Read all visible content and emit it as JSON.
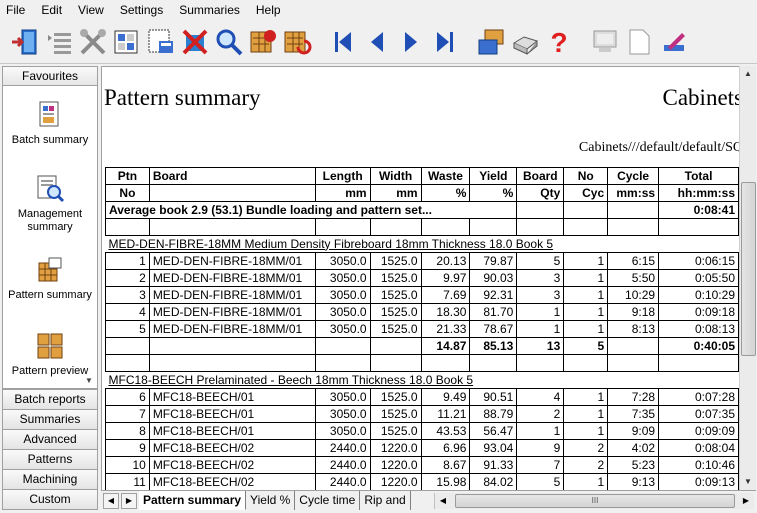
{
  "menu": [
    "File",
    "Edit",
    "View",
    "Settings",
    "Summaries",
    "Help"
  ],
  "toolbar": {
    "buttons": [
      "exit-icon",
      "list-icon",
      "tools-icon",
      "batch-icon",
      "data-icon",
      "delete-icon",
      "search-icon",
      "report-icon",
      "refresh-icon",
      "first-icon",
      "previous-icon",
      "next-icon",
      "last-icon",
      "export-icon",
      "print-icon",
      "help-icon",
      "computer-icon",
      "page-icon",
      "edit-icon"
    ]
  },
  "nav": {
    "header": "Favourites",
    "entries": [
      {
        "label": "Batch summary",
        "icon": "batch-summary-icon"
      },
      {
        "label": "Management summary",
        "icon": "management-summary-icon"
      },
      {
        "label": "Pattern summary",
        "icon": "pattern-summary-icon"
      },
      {
        "label": "Pattern preview",
        "icon": "pattern-preview-icon"
      }
    ],
    "sections": [
      "Batch reports",
      "Summaries",
      "Advanced",
      "Patterns",
      "Machining",
      "Custom"
    ]
  },
  "report": {
    "title": "Pattern summary",
    "company": "Cabinets",
    "path": "Cabinets///default/default/SQ",
    "headers1": [
      "Ptn",
      "Board",
      "Length",
      "Width",
      "Waste",
      "Yield",
      "Board",
      "No",
      "Cycle",
      "Total"
    ],
    "headers2": [
      "No",
      "",
      "mm",
      "mm",
      "%",
      "%",
      "Qty",
      "Cyc",
      "mm:ss",
      "hh:mm:ss"
    ],
    "average": {
      "label": "Average book 2.9 (53.1) Bundle loading and pattern set...",
      "total": "0:08:41"
    },
    "groups": [
      {
        "label": "MED-DEN-FIBRE-18MM Medium Density Fibreboard 18mm Thickness  18.0 Book 5",
        "rows": [
          [
            "1",
            "MED-DEN-FIBRE-18MM/01",
            "3050.0",
            "1525.0",
            "20.13",
            "79.87",
            "5",
            "1",
            "6:15",
            "0:06:15"
          ],
          [
            "2",
            "MED-DEN-FIBRE-18MM/01",
            "3050.0",
            "1525.0",
            "9.97",
            "90.03",
            "3",
            "1",
            "5:50",
            "0:05:50"
          ],
          [
            "3",
            "MED-DEN-FIBRE-18MM/01",
            "3050.0",
            "1525.0",
            "7.69",
            "92.31",
            "3",
            "1",
            "10:29",
            "0:10:29"
          ],
          [
            "4",
            "MED-DEN-FIBRE-18MM/01",
            "3050.0",
            "1525.0",
            "18.30",
            "81.70",
            "1",
            "1",
            "9:18",
            "0:09:18"
          ],
          [
            "5",
            "MED-DEN-FIBRE-18MM/01",
            "3050.0",
            "1525.0",
            "21.33",
            "78.67",
            "1",
            "1",
            "8:13",
            "0:08:13"
          ]
        ],
        "totals": {
          "waste": "14.87",
          "yield": "85.13",
          "qty": "13",
          "cyc": "5",
          "total": "0:40:05"
        }
      },
      {
        "label": "MFC18-BEECH Prelaminated - Beech 18mm Thickness  18.0 Book 5",
        "rows": [
          [
            "6",
            "MFC18-BEECH/01",
            "3050.0",
            "1525.0",
            "9.49",
            "90.51",
            "4",
            "1",
            "7:28",
            "0:07:28"
          ],
          [
            "7",
            "MFC18-BEECH/01",
            "3050.0",
            "1525.0",
            "11.21",
            "88.79",
            "2",
            "1",
            "7:35",
            "0:07:35"
          ],
          [
            "8",
            "MFC18-BEECH/01",
            "3050.0",
            "1525.0",
            "43.53",
            "56.47",
            "1",
            "1",
            "9:09",
            "0:09:09"
          ],
          [
            "9",
            "MFC18-BEECH/02",
            "2440.0",
            "1220.0",
            "6.96",
            "93.04",
            "9",
            "2",
            "4:02",
            "0:08:04"
          ],
          [
            "10",
            "MFC18-BEECH/02",
            "2440.0",
            "1220.0",
            "8.67",
            "91.33",
            "7",
            "2",
            "5:23",
            "0:10:46"
          ],
          [
            "11",
            "MFC18-BEECH/02",
            "2440.0",
            "1220.0",
            "15.98",
            "84.02",
            "5",
            "1",
            "9:13",
            "0:09:13"
          ]
        ]
      }
    ]
  },
  "tabs": [
    "Pattern summary",
    "Yield %",
    "Cycle time",
    "Rip and"
  ],
  "colors": {
    "accent_blue": "#1f4fb4",
    "help_red": "#e02020"
  }
}
